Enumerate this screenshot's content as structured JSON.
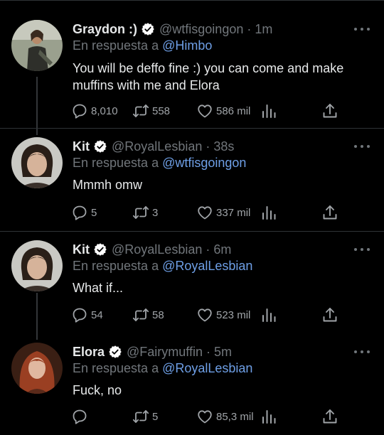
{
  "colors": {
    "background": "#000000",
    "text": "#e7e9ea",
    "secondary_text": "#71767b",
    "mention": "#6e9fe6",
    "separator": "#2f3336",
    "verified_badge": "#ffffff"
  },
  "reply_prefix": "En respuesta a",
  "tweets": [
    {
      "display_name": "Graydon :)",
      "handle": "@wtfisgoingon",
      "time": "1m",
      "reply_to": "@Himbo",
      "text": "You will be deffo fine :) you can come and make muffins with me and Elora",
      "replies": "8,010",
      "retweets": "558",
      "likes": "586 mil"
    },
    {
      "display_name": "Kit",
      "handle": "@RoyalLesbian",
      "time": "38s",
      "reply_to": "@wtfisgoingon",
      "text": "Mmmh omw",
      "replies": "5",
      "retweets": "3",
      "likes": "337 mil"
    },
    {
      "display_name": "Kit",
      "handle": "@RoyalLesbian",
      "time": "6m",
      "reply_to": "@RoyalLesbian",
      "text": "What if...",
      "replies": "54",
      "retweets": "58",
      "likes": "523 mil"
    },
    {
      "display_name": "Elora",
      "handle": "@Fairymuffin",
      "time": "5m",
      "reply_to": "@RoyalLesbian",
      "text": "Fuck, no",
      "replies": "",
      "retweets": "5",
      "likes": "85,3 mil"
    }
  ]
}
